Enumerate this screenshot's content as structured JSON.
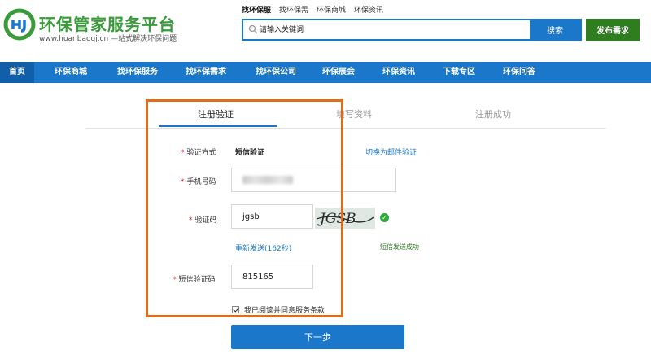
{
  "header": {
    "logo_title": "环保管家服务平台",
    "logo_sub": "www.huanbaogj.cn —站式解决环保问题",
    "brand_color": "#3a9b3a",
    "top_links": [
      "找环保服",
      "找环保需",
      "环保商城",
      "环保资讯"
    ],
    "search": {
      "placeholder": "请输入关键词",
      "button": "搜索"
    },
    "publish_button": "发布需求"
  },
  "nav": {
    "accent": "#1a77c9",
    "items": [
      "首页",
      "环保商城",
      "找环保服务",
      "找环保需求",
      "找环保公司",
      "环保展会",
      "环保资讯",
      "下载专区",
      "环保问答"
    ]
  },
  "steps": [
    "注册验证",
    "填写资料",
    "注册成功"
  ],
  "form": {
    "method_label": "验证方式",
    "method_value": "短信验证",
    "switch_link": "切换为邮件验证",
    "phone_label": "手机号码",
    "captcha_label": "验证码",
    "captcha_value": "jgsb",
    "captcha_image_text": "JGSB",
    "resend": "重新发送(162秒)",
    "sms_success": "短信发送成功",
    "sms_code_label": "短信验证码",
    "sms_code_value": "815165",
    "agree_text": "我已阅读并同意服务条款",
    "agree_checked": true,
    "next_button": "下一步"
  },
  "highlight_color": "#e06c1a"
}
